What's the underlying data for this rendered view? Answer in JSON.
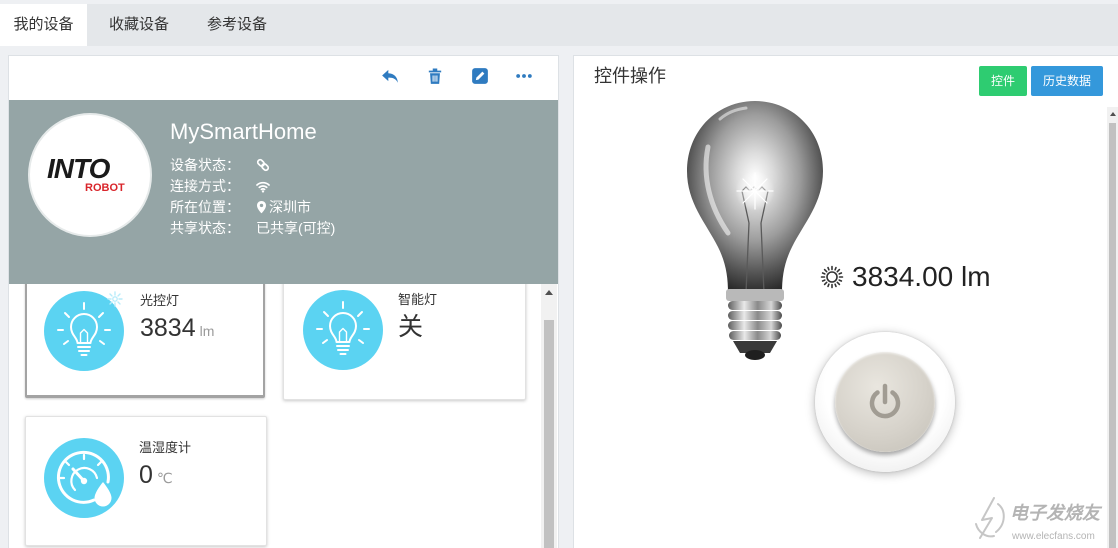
{
  "tabs": [
    {
      "label": "我的设备",
      "active": true
    },
    {
      "label": "收藏设备",
      "active": false
    },
    {
      "label": "参考设备",
      "active": false
    }
  ],
  "toolbar": {
    "actions": [
      {
        "icon": "reply-icon"
      },
      {
        "icon": "trash-icon"
      },
      {
        "icon": "edit-icon"
      },
      {
        "icon": "more-icon"
      }
    ]
  },
  "device": {
    "logo": {
      "main": "INTO",
      "sub": "ROBOT"
    },
    "name": "MySmartHome",
    "fields": [
      {
        "label": "设备状态：",
        "icon": "link-icon"
      },
      {
        "label": "连接方式：",
        "icon": "wifi-icon"
      },
      {
        "label": "所在位置：",
        "icon": "map-marker-icon",
        "value": "深圳市"
      },
      {
        "label": "共享状态：",
        "value": "已共享(可控)"
      }
    ]
  },
  "cards": [
    {
      "name": "光控灯",
      "value": "3834",
      "unit": "lm",
      "icon": "bulb-icon",
      "selected": true
    },
    {
      "name": "智能灯",
      "value": "关",
      "icon": "bulb-icon",
      "selected": false
    },
    {
      "name": "温湿度计",
      "value": "0",
      "unit": "℃",
      "icon": "gauge-drop-icon",
      "selected": false
    }
  ],
  "control_panel": {
    "title": "控件操作",
    "buttons": [
      {
        "label": "控件",
        "color": "#2ecc71"
      },
      {
        "label": "历史数据",
        "color": "#3498db"
      }
    ],
    "reading": {
      "icon": "brightness-icon",
      "value": "3834.00",
      "unit": "lm"
    },
    "power_icon": "power-icon"
  },
  "watermark": {
    "brand": "电子发烧友",
    "url": "www.elecfans.com"
  },
  "colors": {
    "header_bg": "#95a5a6",
    "icon_circle": "#5bd3f2",
    "toolbar_icon": "#2f7bc0",
    "logo_accent": "#d9252b"
  }
}
